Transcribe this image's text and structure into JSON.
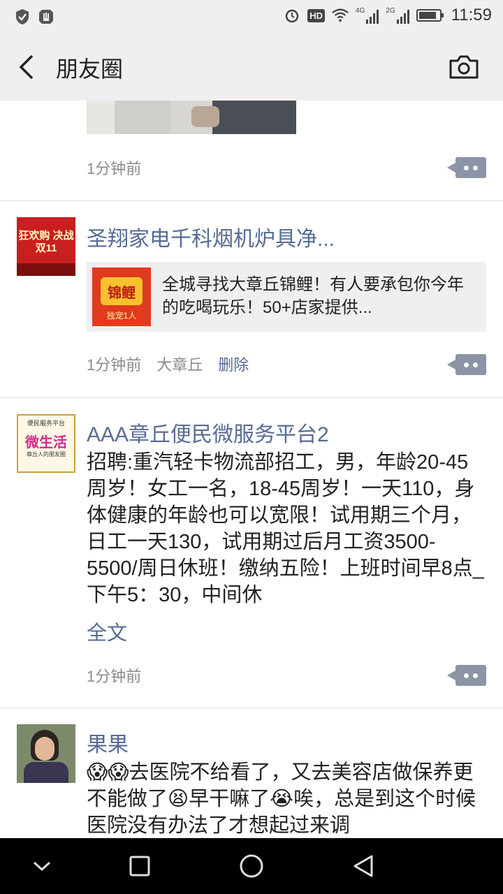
{
  "status": {
    "time": "11:59",
    "hd": "HD",
    "net4g": "4G",
    "net2g": "2G"
  },
  "header": {
    "title": "朋友圈"
  },
  "posts": [
    {
      "time": "1分钟前"
    },
    {
      "name": "圣翔家电千科烟机炉具净...",
      "avatar_text": "狂欢购 决战双11",
      "share_thumb_text": "锦鲤",
      "share_thumb_sub": "独宠1人",
      "share_text": "全城寻找大章丘锦鲤！有人要承包你今年的吃喝玩乐！50+店家提供...",
      "time": "1分钟前",
      "location": "大章丘",
      "delete": "删除"
    },
    {
      "name": "AAA章丘便民微服务平台2",
      "avatar_top": "便民服务平台",
      "avatar_mid": "微生活",
      "avatar_sub": "章丘人的朋友圈",
      "text": "招聘:重汽轻卡物流部招工，男，年龄20-45周岁！女工一名，18-45周岁！一天110，身体健康的年龄也可以宽限！试用期三个月，日工一天130，试用期过后月工资3500-5500/周日休班！缴纳五险！上班时间早8点_下午5：30，中间休",
      "full": "全文",
      "time": "1分钟前"
    },
    {
      "name": "果果",
      "text": "😱😱去医院不给看了，又去美容店做保养更不能做了😫早干嘛了😭唉，总是到这个时候医院没有办法了才想起过来调"
    }
  ],
  "colors": {
    "link": "#576b95",
    "bar": "#efefef"
  }
}
